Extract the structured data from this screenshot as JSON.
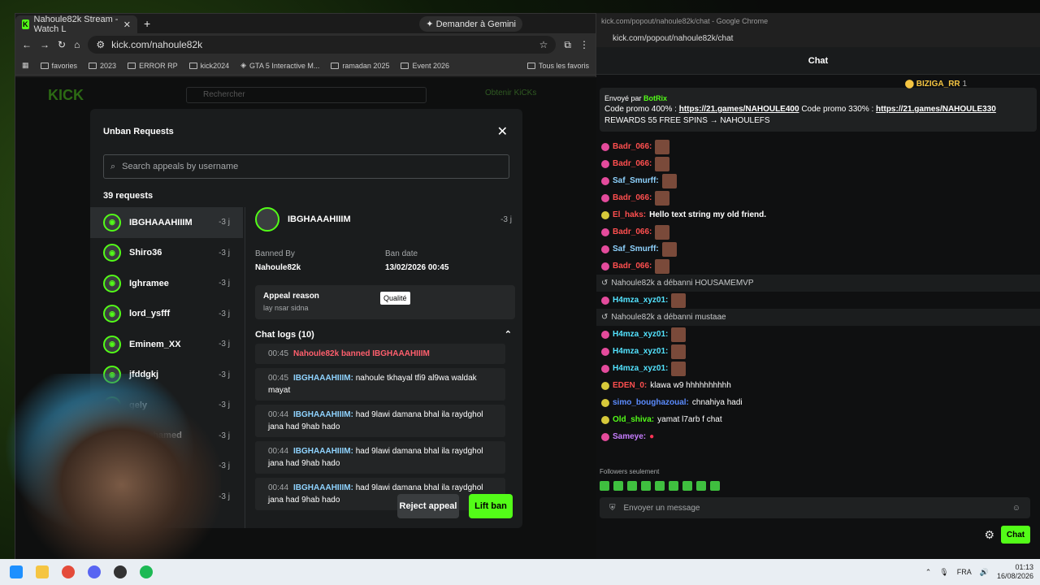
{
  "left_window": {
    "tab_title": "Nahoule82k Stream - Watch L",
    "gemini_label": "Demander à Gemini",
    "url": "kick.com/nahoule82k",
    "bookmarks": [
      "favories",
      "2023",
      "ERROR RP",
      "kick2024",
      "GTA 5 Interactive M...",
      "ramadan 2025",
      "Event 2026"
    ],
    "all_bookmarks": "Tous les favoris",
    "site_search_placeholder": "Rechercher",
    "get_kicks": "Obtenir KiCKs"
  },
  "modal": {
    "title": "Unban Requests",
    "search_placeholder": "Search appeals by username",
    "count": "39 requests",
    "requests": [
      {
        "name": "IBGHAAAHIIIM",
        "ago": "-3 j",
        "selected": true
      },
      {
        "name": "Shiro36",
        "ago": "-3 j"
      },
      {
        "name": "Ighramee",
        "ago": "-3 j"
      },
      {
        "name": "lord_ysfff",
        "ago": "-3 j"
      },
      {
        "name": "Eminem_XX",
        "ago": "-3 j"
      },
      {
        "name": "jfddgkj",
        "ago": "-3 j"
      },
      {
        "name": "gely",
        "ago": "-3 j"
      },
      {
        "name": "chmohamed",
        "ago": "-3 j"
      },
      {
        "name": "8",
        "ago": "-3 j"
      },
      {
        "name": "",
        "ago": "-3 j"
      }
    ],
    "detail": {
      "user": "IBGHAAAHIIIM",
      "ago": "-3 j",
      "banned_by_label": "Banned By",
      "banned_by": "Nahoule82k",
      "ban_date_label": "Ban date",
      "ban_date": "13/02/2026 00:45",
      "appeal_reason_label": "Appeal reason",
      "appeal_reason": "lay nsar sidna",
      "tooltip": "Qualité",
      "chat_logs_label": "Chat logs (10)",
      "logs": [
        {
          "time": "00:45",
          "user": "",
          "text": "Nahoule82k banned IBGHAAAHIIIM",
          "ban": true
        },
        {
          "time": "00:45",
          "user": "IBGHAAAHIIIM:",
          "text": " nahoule tkhayal tfi9 al9wa waldak mayat"
        },
        {
          "time": "00:44",
          "user": "IBGHAAAHIIIM:",
          "text": " had 9lawi damana bhal ila raydghol jana had 9hab hado"
        },
        {
          "time": "00:44",
          "user": "IBGHAAAHIIIM:",
          "text": " had 9lawi damana bhal ila raydghol jana had 9hab hado"
        },
        {
          "time": "00:44",
          "user": "IBGHAAAHIIIM:",
          "text": " had 9lawi damana bhal ila raydghol jana had 9hab hado"
        }
      ]
    },
    "reject_label": "Reject appeal",
    "lift_label": "Lift ban"
  },
  "right_window": {
    "window_title": "kick.com/popout/nahoule82k/chat - Google Chrome",
    "url": "kick.com/popout/nahoule82k/chat",
    "chat_title": "Chat",
    "top_gifter": "BIZIGA_RR",
    "top_gifter_count": "1",
    "pinned_by_label": "Envoyé par",
    "pinned_by": "BotRix",
    "pinned_prefix1": "Code promo 400% : ",
    "pinned_link1": "https://21.games/NAHOULE400",
    "pinned_prefix2": " Code promo 330% : ",
    "pinned_link2": "https://21.games/NAHOULE330",
    "pinned_suffix": " REWARDS 55 FREE SPINS → NAHOULEFS",
    "messages": [
      {
        "user": "Badr_066:",
        "color": "#ff4f4f",
        "text": ""
      },
      {
        "user": "Badr_066:",
        "color": "#ff4f4f",
        "text": ""
      },
      {
        "user": "Saf_Smurff:",
        "color": "#8fd3ff",
        "text": ""
      },
      {
        "user": "Badr_066:",
        "color": "#ff4f4f",
        "text": ""
      },
      {
        "user": "El_haks:",
        "color": "#ff4f4f",
        "text": "Hello text string my old friend."
      },
      {
        "user": "Badr_066:",
        "color": "#ff4f4f",
        "text": ""
      },
      {
        "user": "Saf_Smurff:",
        "color": "#8fd3ff",
        "text": ""
      },
      {
        "user": "Badr_066:",
        "color": "#ff4f4f",
        "text": ""
      },
      {
        "sys": "Nahoule82k a débanni HOUSAMEMVP"
      },
      {
        "user": "H4mza_xyz01:",
        "color": "#53e3ff",
        "text": ""
      },
      {
        "sys": "Nahoule82k a débanni mustaae"
      },
      {
        "user": "H4mza_xyz01:",
        "color": "#53e3ff",
        "text": ""
      },
      {
        "user": "H4mza_xyz01:",
        "color": "#53e3ff",
        "text": ""
      },
      {
        "user": "H4mza_xyz01:",
        "color": "#53e3ff",
        "text": ""
      },
      {
        "user": "EDEN_0:",
        "color": "#ff4f4f",
        "text": " klawa w9 hhhhhhhhhh"
      },
      {
        "user": "simo_boughazoual:",
        "color": "#5b8cff",
        "text": " chnahiya hadi"
      },
      {
        "user": "Old_shiva:",
        "color": "#53fc18",
        "text": " yamat l7arb f chat"
      },
      {
        "user": "Sameye:",
        "color": "#c77dff",
        "text": ""
      }
    ],
    "followers_only": "Followers seulement",
    "input_placeholder": "Envoyer un message",
    "send_label": "Chat"
  },
  "taskbar": {
    "lang": "FRA",
    "time": "01:13",
    "date": "16/08/2026"
  }
}
